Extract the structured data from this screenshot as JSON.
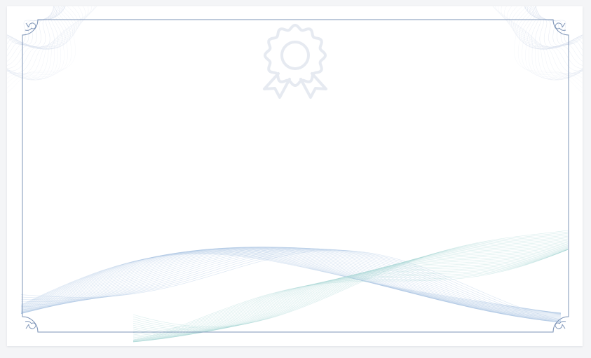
{
  "certificate": {
    "template": "blank-certificate",
    "emblem": "award-ribbon-icon",
    "colors": {
      "background": "#ffffff",
      "frame": "#7d94b7",
      "emblem": "#e6eaf1",
      "guilloche": "#c8d3e6",
      "wave_blue": "#a9c3e2",
      "wave_teal": "#a9d8d4"
    }
  }
}
